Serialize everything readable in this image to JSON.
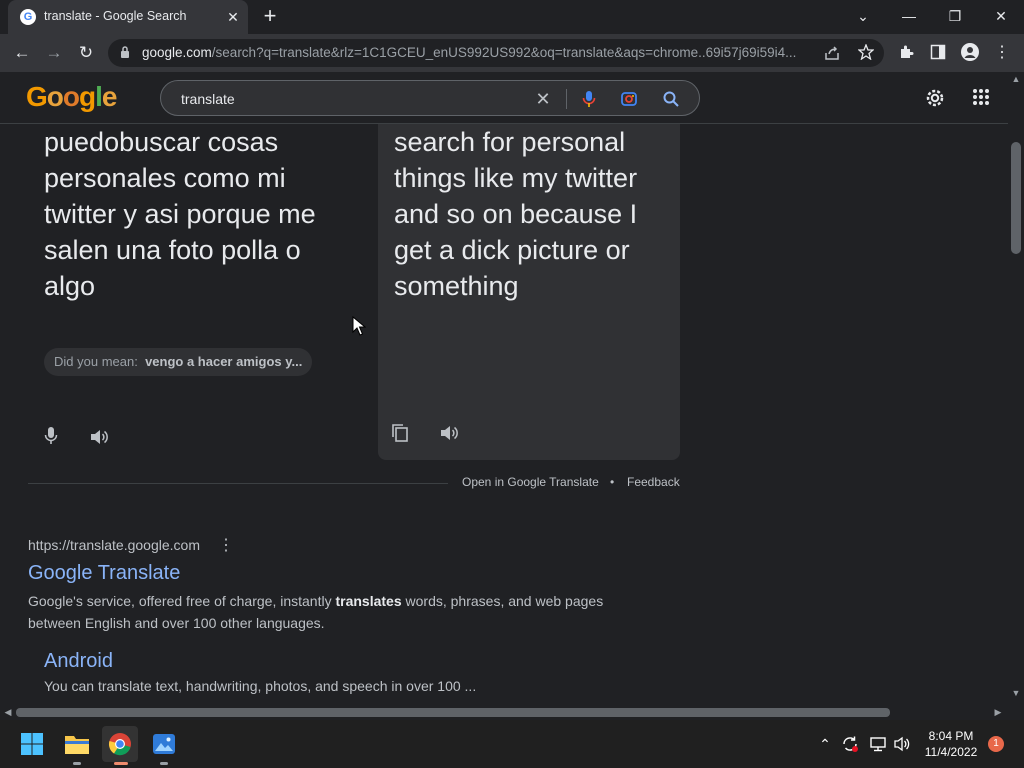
{
  "browser": {
    "tab": {
      "title": "translate - Google Search",
      "favicon": "G",
      "close": "✕"
    },
    "new_tab": "+",
    "window_controls": {
      "down": "⌄",
      "minimize": "—",
      "restore": "❐",
      "close": "✕"
    },
    "nav": {
      "back": "←",
      "forward": "→",
      "reload": "↻"
    },
    "url_host": "google.com",
    "url_rest": "/search?q=translate&rlz=1C1GCEU_enUS992US992&oq=translate&aqs=chrome..69i57j69i59i4..."
  },
  "google": {
    "logo": "Google",
    "query": "translate",
    "apps_icon": "⋮⋮⋮"
  },
  "translator": {
    "source_text": "puedobuscar cosas personales como mi twitter y asi porque me salen una foto polla o algo",
    "target_text": "search for personal things like my twitter and so on because I get a dick picture or something",
    "did_you_mean_label": "Did you mean:",
    "did_you_mean_value": "vengo a hacer amigos y...",
    "open_in_translate": "Open in Google Translate",
    "separator": "•",
    "feedback": "Feedback"
  },
  "result": {
    "cite": "https://translate.google.com",
    "title": "Google Translate",
    "snippet_pre": "Google's service, offered free of charge, instantly ",
    "snippet_bold": "translates",
    "snippet_post": " words, phrases, and web pages between English and over 100 other languages.",
    "sub_title": "Android",
    "sub_snippet": "You can translate text, handwriting, photos, and speech in over 100 ..."
  },
  "taskbar": {
    "time": "8:04 PM",
    "date": "11/4/2022",
    "notification_count": "1"
  },
  "colors": {
    "link": "#8ab4f8",
    "background": "#202124",
    "panel": "#303134"
  }
}
